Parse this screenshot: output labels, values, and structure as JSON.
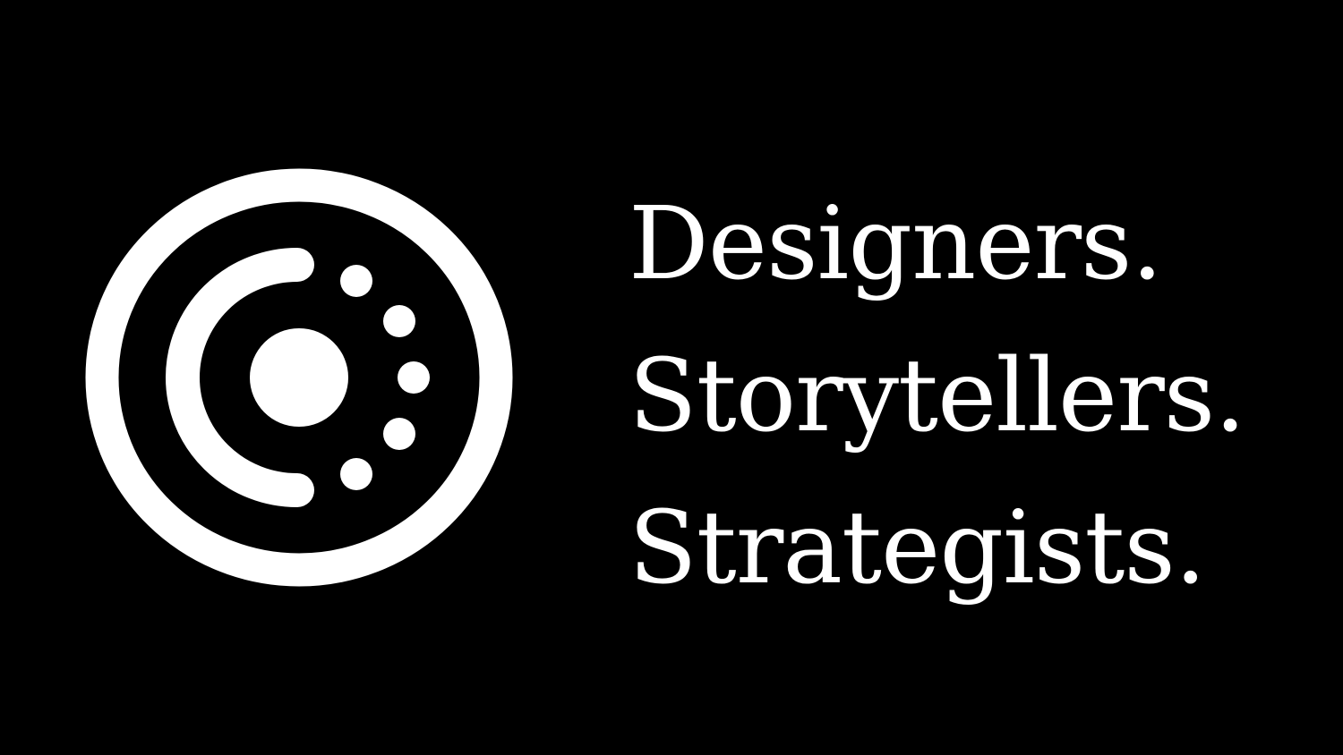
{
  "background_color": "#000000",
  "foreground_color": "#ffffff",
  "logo": {
    "icon": "ring-arc-dots-logo-icon"
  },
  "tagline": {
    "lines": [
      "Designers.",
      "Storytellers.",
      "Strategists."
    ]
  }
}
